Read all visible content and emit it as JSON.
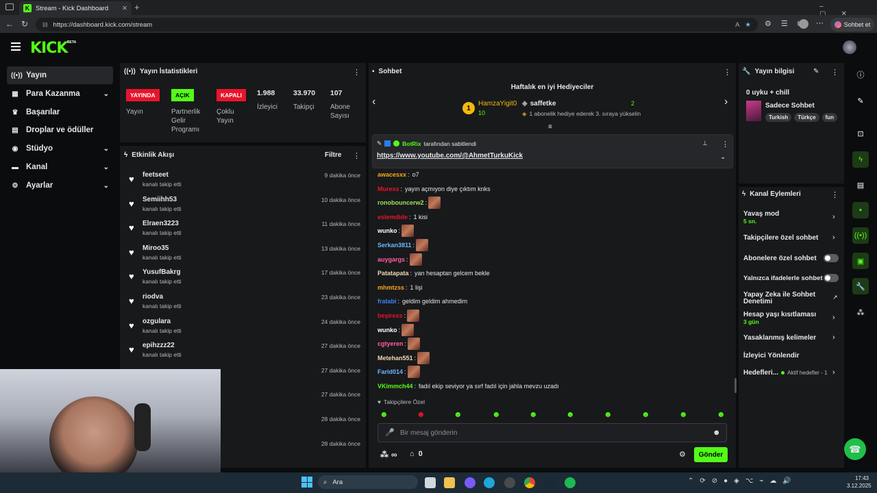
{
  "browser": {
    "tab_title": "Stream - Kick Dashboard",
    "url": "https://dashboard.kick.com/stream",
    "sohbet_et": "Sohbet et"
  },
  "app": {
    "logo": "KICK",
    "beta": "BETA"
  },
  "sidebar": {
    "items": [
      {
        "label": "Yayın",
        "icon": "broadcast-icon"
      },
      {
        "label": "Para Kazanma",
        "icon": "monetization-icon"
      },
      {
        "label": "Başarılar",
        "icon": "trophy-icon"
      },
      {
        "label": "Droplar ve ödüller",
        "icon": "gift-icon"
      },
      {
        "label": "Stüdyo",
        "icon": "studio-icon"
      },
      {
        "label": "Kanal",
        "icon": "channel-icon"
      },
      {
        "label": "Ayarlar",
        "icon": "gear-icon"
      }
    ]
  },
  "stats": {
    "title": "Yayın İstatistikleri",
    "badges": [
      {
        "label": "YAYINDA",
        "sub": "Yayın",
        "color": "#e8142b"
      },
      {
        "label": "AÇIK",
        "sub": "Partnerlik Gelir Programı",
        "color": "#53fc18"
      },
      {
        "label": "KAPALI",
        "sub": "Çoklu Yayın",
        "color": "#e8142b"
      }
    ],
    "numbers": [
      {
        "value": "1.988",
        "label": "İzleyici"
      },
      {
        "value": "33.970",
        "label": "Takipçi"
      },
      {
        "value": "107",
        "label": "Abone Sayısı"
      }
    ]
  },
  "activity": {
    "title": "Etkinlik Akışı",
    "filter": "Filtre",
    "events": [
      {
        "name": "feetseet",
        "sub": "kanalı takip etti",
        "time": "9 dakika önce"
      },
      {
        "name": "Semiihh53",
        "sub": "kanalı takip etti",
        "time": "10 dakika önce"
      },
      {
        "name": "Elraen3223",
        "sub": "kanalı takip etti",
        "time": "11 dakika önce"
      },
      {
        "name": "Miroo35",
        "sub": "kanalı takip etti",
        "time": "13 dakika önce"
      },
      {
        "name": "YusufBakrg",
        "sub": "kanalı takip etti",
        "time": "17 dakika önce"
      },
      {
        "name": "riodva",
        "sub": "kanalı takip etti",
        "time": "23 dakika önce"
      },
      {
        "name": "ozgulara",
        "sub": "kanalı takip etti",
        "time": "24 dakika önce"
      },
      {
        "name": "epihzzz22",
        "sub": "kanalı takip etti",
        "time": "27 dakika önce"
      },
      {
        "name": "",
        "sub": "",
        "time": "27 dakika önce"
      },
      {
        "name": "",
        "sub": "",
        "time": "27 dakika önce"
      },
      {
        "name": "",
        "sub": "",
        "time": "28 dakika önce"
      },
      {
        "name": "",
        "sub": "",
        "time": "28 dakika önce"
      }
    ]
  },
  "chat": {
    "title": "Sohbet",
    "gifters_title": "Haftalık en iyi Hediyeciler",
    "gifter1": {
      "rank": "1",
      "name": "HamzaYigit0",
      "count": "10"
    },
    "gifter2": {
      "name": "saffetke",
      "count": "2",
      "note": "1 abonelik hediye ederek 3. sıraya yükselin"
    },
    "pinned": {
      "by": "BotRix",
      "by_suffix": "tarafından sabitlendi",
      "link": "https://www.youtube.com/@AhmetTurkuKick"
    },
    "messages": [
      {
        "user": "awacesxx",
        "color": "#f5a623",
        "text": "o7",
        "emote": false
      },
      {
        "user": "Murexs",
        "color": "#e8142b",
        "text": "yayın açmıyon diye çıktım knks",
        "emote": false
      },
      {
        "user": "ronobouncerw2",
        "color": "#9be15d",
        "text": "",
        "emote": true
      },
      {
        "user": "eslemdide",
        "color": "#e8142b",
        "text": "1 kisi",
        "emote": false
      },
      {
        "user": "wunko",
        "color": "#ffffff",
        "text": "",
        "emote": true
      },
      {
        "user": "Serkan3811",
        "color": "#6ab7ff",
        "text": "",
        "emote": true
      },
      {
        "user": "auygargs",
        "color": "#ff5fa2",
        "text": "",
        "emote": true
      },
      {
        "user": "Patatapata",
        "color": "#f0d9b5",
        "text": "yan hesaptan gelcem bekle",
        "emote": false
      },
      {
        "user": "mhmtzss",
        "color": "#f5a623",
        "text": "1 lişi",
        "emote": false
      },
      {
        "user": "fratabi",
        "color": "#3b82f6",
        "text": "geldim geldim ahmedim",
        "emote": false
      },
      {
        "user": "beşirexs",
        "color": "#e8142b",
        "text": "",
        "emote": true
      },
      {
        "user": "wunko",
        "color": "#ffffff",
        "text": "",
        "emote": true
      },
      {
        "user": "cgtyeren",
        "color": "#ff5fa2",
        "text": "",
        "emote": true
      },
      {
        "user": "Metehan551",
        "color": "#f0d9b5",
        "text": "",
        "emote": true
      },
      {
        "user": "Farid014",
        "color": "#6ab7ff",
        "text": "",
        "emote": true
      },
      {
        "user": "VKimmch44",
        "color": "#53fc18",
        "text": "fadıl ekip seviyor ya sırf fadıl için jahla mevzu uzadı",
        "emote": false
      }
    ],
    "followers_only": "Takipçilere Özel",
    "input_placeholder": "Bir mesaj gönderin",
    "infinity": "∞",
    "store_count": "0",
    "send_label": "Gönder"
  },
  "stream_info": {
    "title": "Yayın bilgisi",
    "stream_title": "0 uyku + chill",
    "category": "Sadece Sohbet",
    "tags": [
      "Turkish",
      "Türkçe",
      "fun"
    ]
  },
  "channel_actions": {
    "title": "Kanal Eylemleri",
    "slow_mode": "Yavaş mod",
    "slow_mode_val": "5 sn.",
    "followers_chat": "Takipçilere özel sohbet",
    "subs_chat": "Abonelere özel sohbet",
    "emote_chat": "Yalnızca ifadelerle sohbet",
    "ai_chat": "Yapay Zeka ile Sohbet Denetimi",
    "account_age": "Hesap yaşı kısıtlaması",
    "account_age_val": "3 gün",
    "banned_words": "Yasaklanmış kelimeler",
    "raid": "İzleyici Yönlendir",
    "goals": "Hedefleri...",
    "goals_status": "Aktif hedefler - 1"
  },
  "taskbar": {
    "search": "Ara",
    "time": "17:43",
    "date": "3.12.2025"
  }
}
